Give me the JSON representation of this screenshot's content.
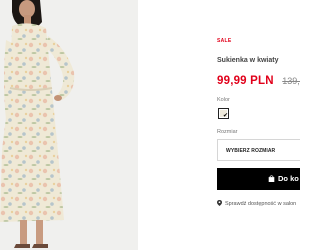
{
  "product": {
    "badge": "SALE",
    "name": "Sukienka w kwiaty",
    "price_current": "99,99 PLN",
    "price_old": "139,9",
    "vat_note": "",
    "image_alt": "Model wearing a long floral print dress"
  },
  "color": {
    "label": "Kolor",
    "selected_swatch_hex": "#efeadb"
  },
  "size": {
    "label": "Rozmiar",
    "select_placeholder": "WYBIERZ ROZMIAR"
  },
  "cart": {
    "button_label": "Do ko",
    "icon": "shopping-bag-icon"
  },
  "availability": {
    "text": "Sprawdź dostępność w salon",
    "icon": "location-pin-icon"
  },
  "colors": {
    "sale_red": "#e1001a",
    "button_black": "#000000"
  }
}
